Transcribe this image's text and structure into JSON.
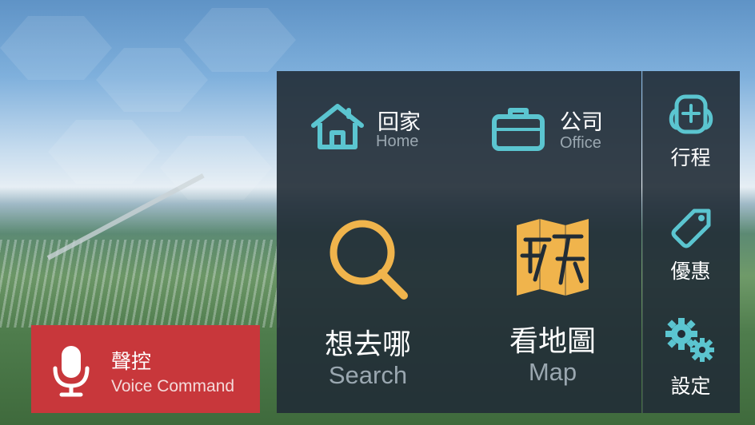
{
  "quick": {
    "home": {
      "zh": "回家",
      "en": "Home"
    },
    "office": {
      "zh": "公司",
      "en": "Office"
    }
  },
  "main": {
    "search": {
      "zh": "想去哪",
      "en": "Search"
    },
    "map": {
      "zh": "看地圖",
      "en": "Map"
    }
  },
  "sidebar": {
    "items": [
      {
        "label": "行程",
        "icon": "backpack-icon"
      },
      {
        "label": "優惠",
        "icon": "tag-icon"
      },
      {
        "label": "設定",
        "icon": "gears-icon"
      }
    ]
  },
  "voice": {
    "zh": "聲控",
    "en": "Voice Command"
  },
  "colors": {
    "teal": "#5bc5d0",
    "gold": "#f0b44c",
    "panel": "#212c36",
    "voice_red": "#c8373b",
    "subtext": "#9aa7b0"
  }
}
